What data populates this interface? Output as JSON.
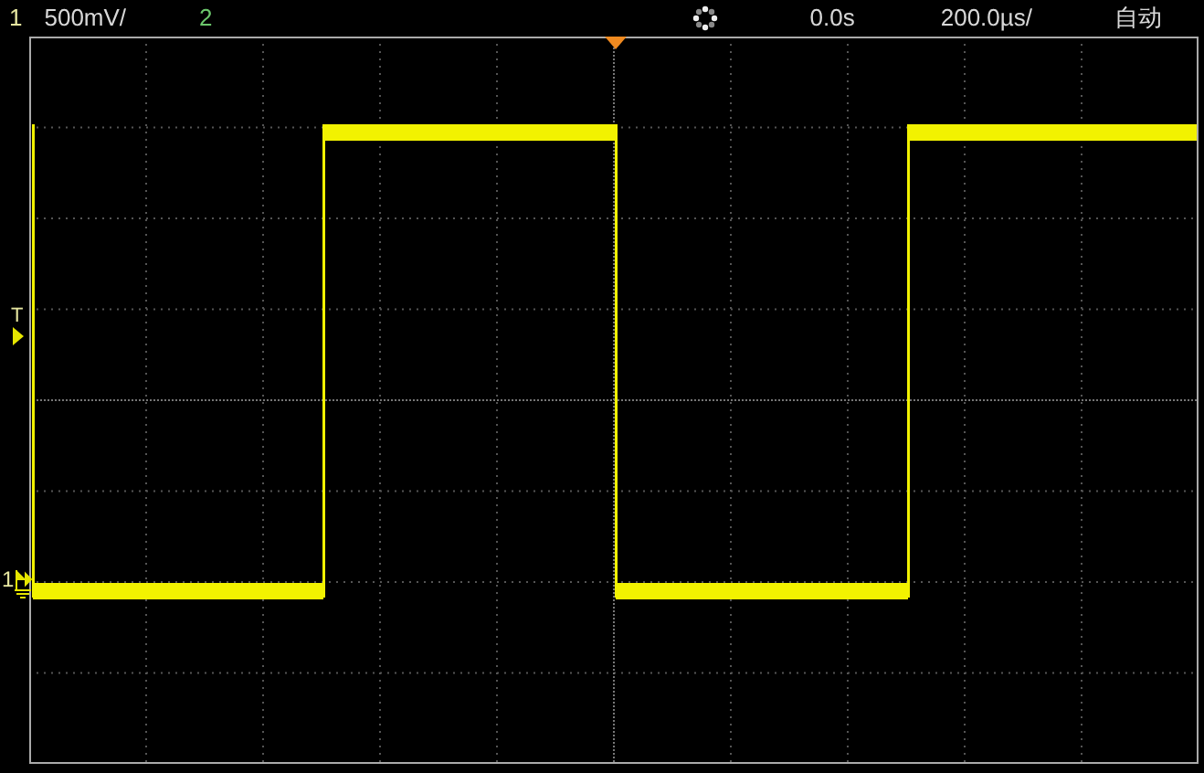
{
  "top_bar": {
    "channels": [
      {
        "label": "1",
        "scale": "500mV/",
        "color": "#e6e6a0"
      },
      {
        "label": "2",
        "color": "#6cc86c"
      }
    ],
    "time_offset": "0.0s",
    "timebase": "200.0µs/",
    "acquisition_mode": "自动"
  },
  "display": {
    "trigger_level_marker": "T",
    "channel_marker": "1"
  }
}
